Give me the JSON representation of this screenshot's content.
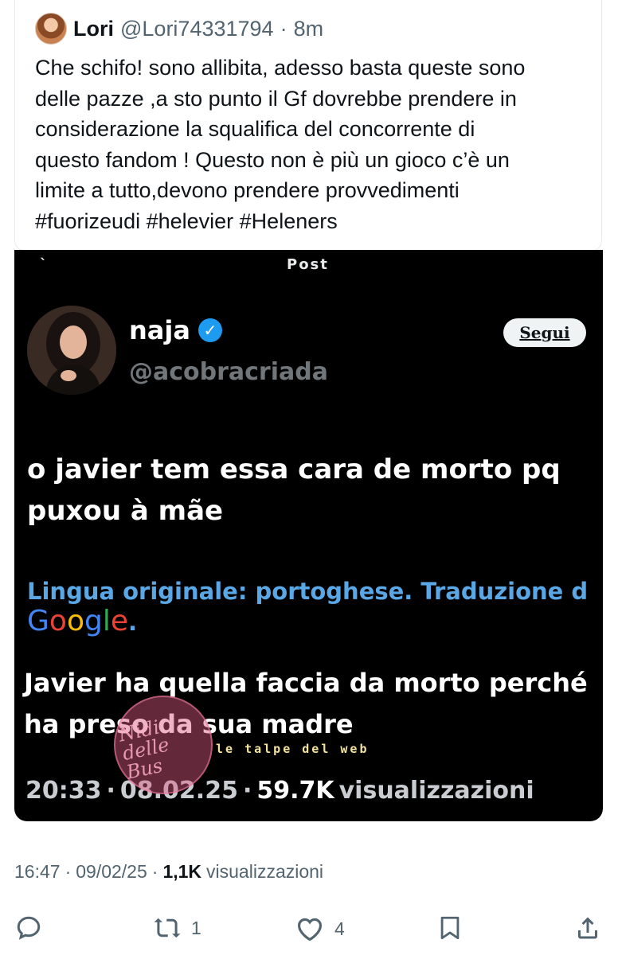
{
  "tweet": {
    "author_name": "Lori",
    "author_handle": "@Lori74331794",
    "dot": "·",
    "time_ago": "8m",
    "text": "Che schifo! sono allibita, adesso basta queste sono\ndelle pazze ,a sto punto il Gf dovrebbe prendere in\nconsiderazione la squalifica del concorrente di\nquesto fandom ! Questo non è più un gioco c’è un\nlimite a tutto,devono  prendere provvedimenti\n#fuorizeudi #helevier #Heleners"
  },
  "quoted": {
    "top_fragment_left": "`",
    "top_fragment_center": "Post",
    "author_name": "naja",
    "verified_mark": "✓",
    "author_handle": "@acobracriada",
    "follow_label": "Segui",
    "text": "o javier tem essa cara de morto pq puxou à mãe",
    "translation_note": "Lingua originale: portoghese. Traduzione d",
    "google": {
      "g1": "G",
      "o1": "o",
      "o2": "o",
      "g2": "g",
      "l": "l",
      "e": "e",
      "dot": "."
    },
    "translated": "Javier ha quella faccia da morto perché ha preso da sua madre",
    "time": "20:33",
    "date": "08.02.25",
    "views_count": "59.7K",
    "views_label": "visualizzazioni",
    "sep": "·"
  },
  "watermark": {
    "circle_text": "Nidi delle Bus",
    "label": "le talpe del web"
  },
  "footer": {
    "time": "16:47",
    "date": "09/02/25",
    "views": "1,1K",
    "views_label": "visualizzazioni",
    "sep": "·"
  },
  "actions": {
    "reply_icon": "reply-icon",
    "retweet_count": "1",
    "like_count": "4",
    "bookmark_icon": "bookmark-icon",
    "share_icon": "share-icon"
  },
  "colors": {
    "link_blue": "#5aa7e6",
    "verified_blue": "#1d9bf0",
    "muted": "#536471"
  }
}
